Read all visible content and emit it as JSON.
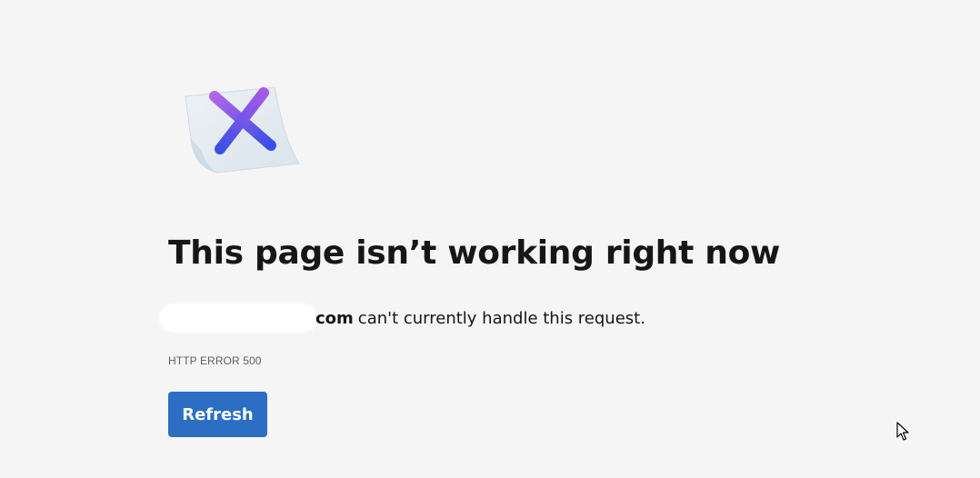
{
  "illustration": {
    "icon": "error-x-icon",
    "colors": {
      "paper": "#e6eef3",
      "x_start": "#a35ae8",
      "x_end": "#3f52e8"
    }
  },
  "title": "This page isn’t working right now",
  "message": {
    "domain_suffix": "com",
    "text": "can't currently handle this request."
  },
  "error_code": "HTTP ERROR 500",
  "refresh_button": {
    "label": "Refresh",
    "color": "#2b6ec4"
  }
}
